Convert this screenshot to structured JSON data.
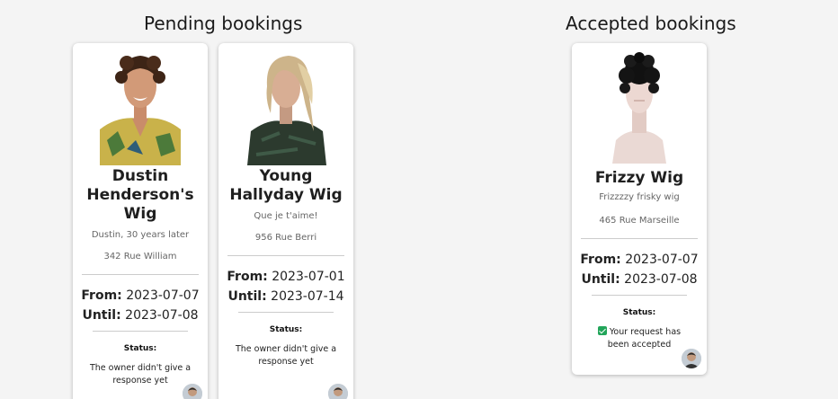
{
  "pending": {
    "title": "Pending bookings",
    "cards": [
      {
        "name": "Dustin Henderson's Wig",
        "description": "Dustin, 30 years later",
        "address": "342 Rue William",
        "from_label": "From:",
        "from": "2023-07-07",
        "until_label": "Until:",
        "until": "2023-07-08",
        "status_label": "Status:",
        "status_text": "The owner didn't give a response yet"
      },
      {
        "name": "Young Hallyday Wig",
        "description": "Que je t'aime!",
        "address": "956 Rue Berri",
        "from_label": "From:",
        "from": "2023-07-01",
        "until_label": "Until:",
        "until": "2023-07-14",
        "status_label": "Status:",
        "status_text": "The owner didn't give a response yet"
      }
    ]
  },
  "accepted": {
    "title": "Accepted bookings",
    "cards": [
      {
        "name": "Frizzy Wig",
        "description": "Frizzzzy frisky wig",
        "address": "465 Rue Marseille",
        "from_label": "From:",
        "from": "2023-07-07",
        "until_label": "Until:",
        "until": "2023-07-08",
        "status_label": "Status:",
        "status_text": "Your request has been accepted"
      }
    ]
  },
  "colors": {
    "accepted_check": "#22a55a",
    "background": "#f4f4f4",
    "card": "#ffffff"
  }
}
